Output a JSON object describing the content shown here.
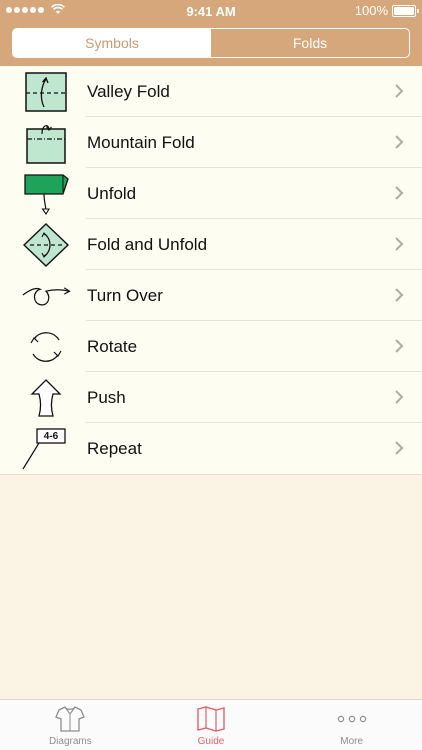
{
  "status": {
    "time": "9:41 AM",
    "battery": "100%"
  },
  "segments": [
    {
      "label": "Symbols",
      "active": true
    },
    {
      "label": "Folds",
      "active": false
    }
  ],
  "rows": [
    {
      "label": "Valley Fold",
      "icon": "valley-fold-icon"
    },
    {
      "label": "Mountain Fold",
      "icon": "mountain-fold-icon"
    },
    {
      "label": "Unfold",
      "icon": "unfold-icon"
    },
    {
      "label": "Fold and Unfold",
      "icon": "fold-and-unfold-icon"
    },
    {
      "label": "Turn Over",
      "icon": "turn-over-icon"
    },
    {
      "label": "Rotate",
      "icon": "rotate-icon"
    },
    {
      "label": "Push",
      "icon": "push-icon"
    },
    {
      "label": "Repeat",
      "icon": "repeat-icon",
      "badge": "4-6"
    }
  ],
  "tabs": [
    {
      "label": "Diagrams",
      "icon": "shirt-icon",
      "active": false
    },
    {
      "label": "Guide",
      "icon": "map-icon",
      "active": true
    },
    {
      "label": "More",
      "icon": "more-dots-icon",
      "active": false
    }
  ],
  "colors": {
    "header": "#d5a77a",
    "paper_light": "#bfe6cf",
    "paper_green": "#1fa25a",
    "active_tab": "#e0626a"
  }
}
